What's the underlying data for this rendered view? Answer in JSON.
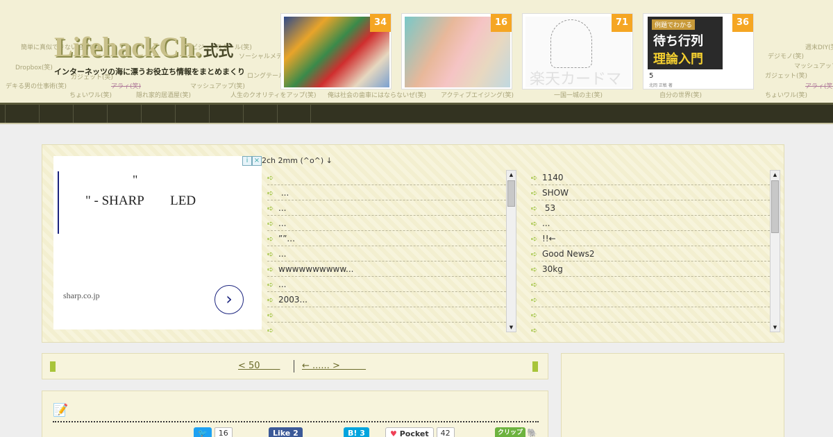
{
  "header": {
    "logo_text": "LifehackCh.",
    "logo_suffix": "式式",
    "tagline": "インターネッツの海に漂うお役立ち情報をまとめまくり",
    "tag_cloud": [
      "簡単に真似できない自分(笑)",
      "Dropbox(笑)",
      "デキる男の仕事術(笑)",
      "ちょいワル(笑)",
      "隠れ家的居酒屋(笑)",
      "アラィ(笑)",
      "マッシュアップ(笑)",
      "人生のクオリティをアップ(笑)",
      "俺は社会の歯車にはならないぜ(笑)",
      "アクティブエイジング(笑)",
      "一国一城の主(笑)",
      "自分の世界(笑)",
      "ちょいワル(笑)",
      "アラィ(笑)",
      "週末DIY(笑)",
      "デジモノ(笑)",
      "マッシュアップ(笑)",
      "ガジェット(笑)",
      "ソーシャルメディア",
      "ロングテール",
      "ガジェット(笑)",
      "ビジュースクール(笑)"
    ],
    "thumbnails": [
      {
        "count": "34"
      },
      {
        "count": "16"
      },
      {
        "count": "71",
        "overlay_text": "楽天カードマン"
      },
      {
        "count": "36",
        "book_banner": "例題でわかる",
        "book_title_1": "待ち行列",
        "book_title_2": "理論入門",
        "book_number": "5",
        "book_author": "北岡 正敏 著"
      }
    ]
  },
  "nav": {
    "items": [
      "",
      "",
      "",
      "",
      "",
      "",
      "",
      "",
      ""
    ]
  },
  "ad": {
    "info_icon": "i",
    "close_icon": "×",
    "line1": "\"",
    "line2": "\" - SHARP        LED",
    "domain": "sharp.co.jp",
    "arrow": "›"
  },
  "feed": {
    "title": "2ch  2mm (^o^) ↓",
    "left_items": [
      "",
      " ...",
      "...",
      "...",
      "””...",
      "...",
      "wwwwwwwwww...",
      "...",
      "2003...",
      "",
      ""
    ],
    "right_items": [
      "1140",
      "SHOW",
      " 53",
      "...",
      "!!←",
      "Good News2",
      "30kg",
      "",
      "",
      "",
      ""
    ]
  },
  "pager": {
    "prev": "< 50       ",
    "next": "← ...... >         "
  },
  "share": {
    "twitter_label": "",
    "twitter_count": "16",
    "facebook_label": "Like 2",
    "hatena_label": "B! 3",
    "pocket_label": "Pocket",
    "pocket_count": "42",
    "clip_label": "クリップ"
  },
  "colors": {
    "header_bg": "#f3f0d6",
    "nav_bg": "#333321",
    "box_bg": "#f7f4dc",
    "badge": "#f5a623",
    "arrow_green": "#8cb81f"
  }
}
